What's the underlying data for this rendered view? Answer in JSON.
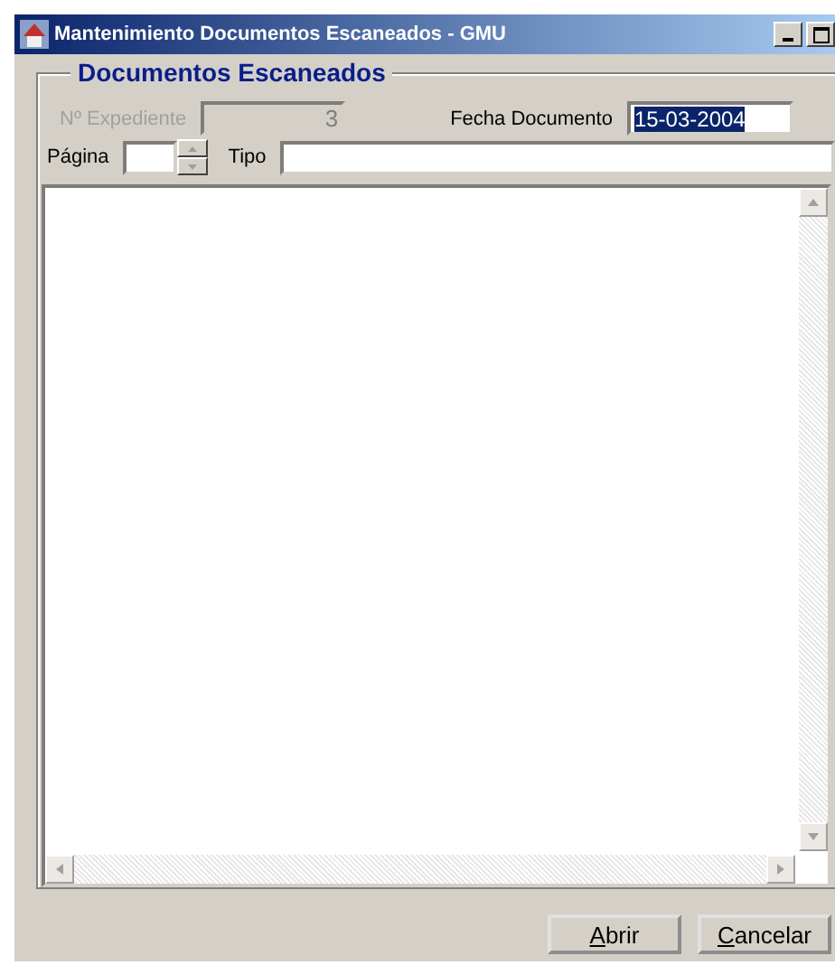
{
  "window": {
    "title": "Mantenimiento Documentos Escaneados - GMU"
  },
  "group": {
    "title": "Documentos Escaneados"
  },
  "fields": [
    {
      "label": "Nº Expediente",
      "value": "3",
      "disabled": true,
      "selected": false
    },
    {
      "label": "Fecha Documento",
      "value": "15-03-2004",
      "disabled": false,
      "selected": true
    }
  ],
  "pagina": {
    "label": "Página"
  },
  "tipo": {
    "label": "Tipo"
  },
  "buttons": [
    {
      "accel": "A",
      "rest": "brir"
    },
    {
      "accel": "C",
      "rest": "ancelar"
    }
  ]
}
